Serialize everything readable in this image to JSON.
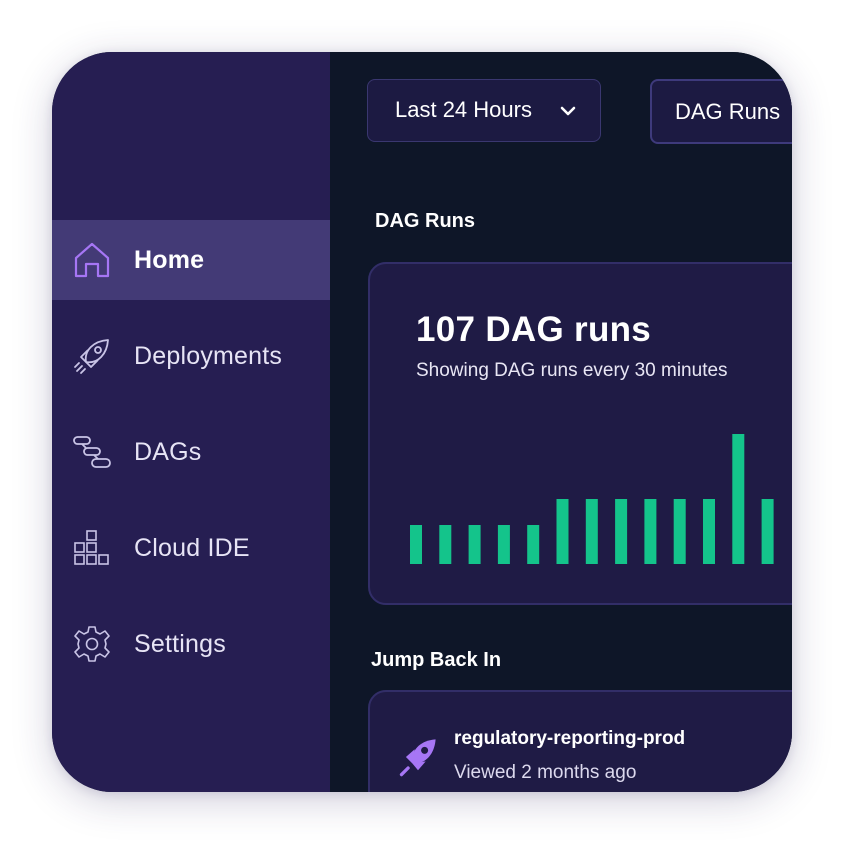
{
  "sidebar": {
    "items": [
      {
        "label": "Home",
        "icon": "home-icon",
        "active": true
      },
      {
        "label": "Deployments",
        "icon": "rocket-icon",
        "active": false
      },
      {
        "label": "DAGs",
        "icon": "dag-icon",
        "active": false
      },
      {
        "label": "Cloud IDE",
        "icon": "cloud-ide-icon",
        "active": false
      },
      {
        "label": "Settings",
        "icon": "gear-icon",
        "active": false
      }
    ]
  },
  "toolbar": {
    "time_range": "Last 24 Hours",
    "view_tab": "DAG Runs"
  },
  "dag_runs": {
    "section_title": "DAG Runs",
    "count_label": "107 DAG runs",
    "subtitle": "Showing DAG runs every 30 minutes"
  },
  "chart_data": {
    "type": "bar",
    "values": [
      3,
      3,
      3,
      3,
      3,
      5,
      5,
      5,
      5,
      5,
      5,
      10,
      5
    ],
    "ylim": [
      0,
      10
    ],
    "grid": false,
    "bar_color": "#14c48b"
  },
  "jump_back": {
    "section_title": "Jump Back In",
    "item_name": "regulatory-reporting-prod",
    "item_meta": "Viewed 2 months ago",
    "item_icon": "rocket-icon"
  },
  "colors": {
    "sidebar_bg": "#261e52",
    "sidebar_active_bg": "#433a76",
    "accent": "#a676f5",
    "main_bg": "#0e1628",
    "card_bg": "#1f1b45",
    "bar": "#14c48b"
  }
}
